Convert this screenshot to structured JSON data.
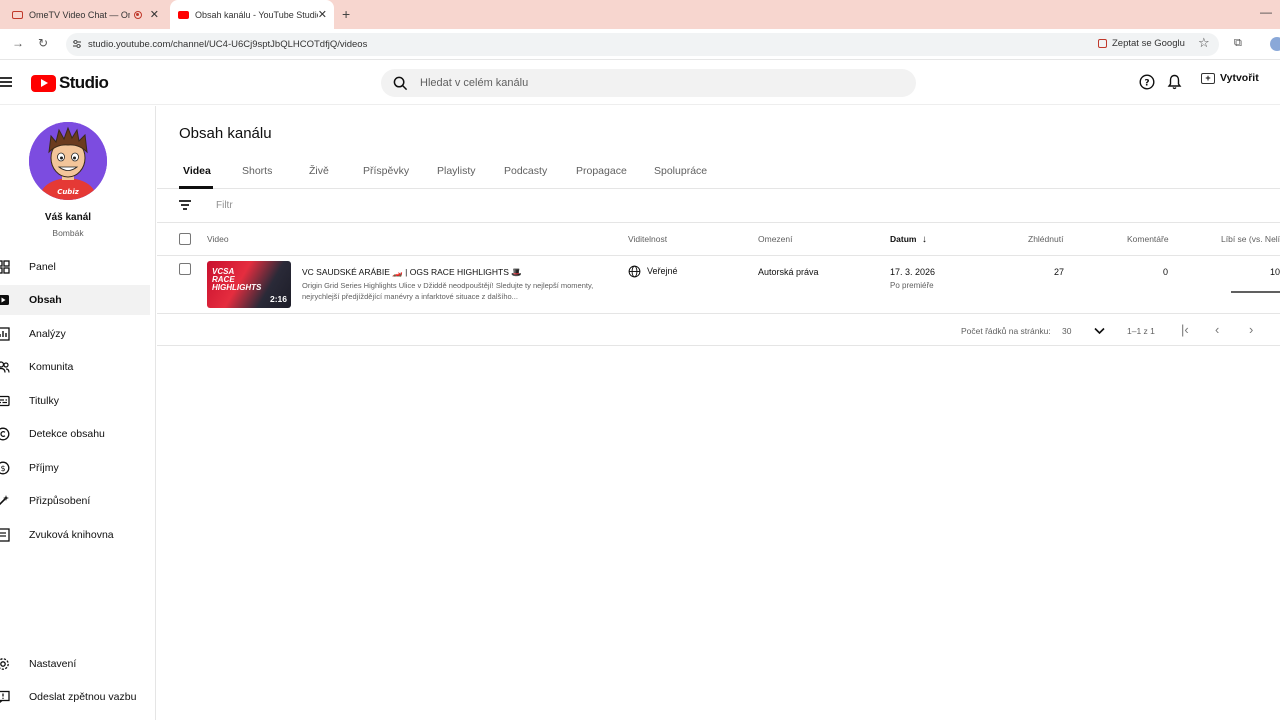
{
  "browser": {
    "tabs": [
      {
        "title": "OmeTV Video Chat — Omegle",
        "active": false
      },
      {
        "title": "Obsah kanálu - YouTube Studio",
        "active": true
      }
    ],
    "url": "studio.youtube.com/channel/UC4-U6Cj9sptJbQLHCOTdfjQ/videos",
    "ask_google": "Zeptat se Googlu"
  },
  "header": {
    "logo_text": "Studio",
    "search_placeholder": "Hledat v celém kanálu",
    "create_label": "Vytvořit"
  },
  "sidebar": {
    "channel_label": "Váš kanál",
    "channel_name": "Bombák",
    "items": [
      {
        "label": "Panel",
        "icon": "dashboard-icon"
      },
      {
        "label": "Obsah",
        "icon": "content-icon",
        "active": true
      },
      {
        "label": "Analýzy",
        "icon": "analytics-icon"
      },
      {
        "label": "Komunita",
        "icon": "community-icon"
      },
      {
        "label": "Titulky",
        "icon": "subtitles-icon"
      },
      {
        "label": "Detekce obsahu",
        "icon": "copyright-icon"
      },
      {
        "label": "Příjmy",
        "icon": "earn-icon"
      },
      {
        "label": "Přizpůsobení",
        "icon": "customization-icon"
      },
      {
        "label": "Zvuková knihovna",
        "icon": "audio-library-icon"
      }
    ],
    "bottom": [
      {
        "label": "Nastavení",
        "icon": "settings-icon"
      },
      {
        "label": "Odeslat zpětnou vazbu",
        "icon": "feedback-icon"
      }
    ]
  },
  "main": {
    "title": "Obsah kanálu",
    "tabs": [
      "Videa",
      "Shorts",
      "Živě",
      "Příspěvky",
      "Playlisty",
      "Podcasty",
      "Propagace",
      "Spolupráce"
    ],
    "active_tab": "Videa",
    "filter_placeholder": "Filtr",
    "columns": {
      "video": "Video",
      "visibility": "Viditelnost",
      "restrictions": "Omezení",
      "date": "Datum",
      "views": "Zhlédnutí",
      "comments": "Komentáře",
      "likes": "Líbí se (vs. Nelíbí se)"
    },
    "rows": [
      {
        "title": "VC SAUDSKÉ ARÁBIE 🏎️ | OGS RACE HIGHLIGHTS 🎩",
        "description": "Origin Grid Series Highlights Ulice v Džiddě neodpouštějí! Sledujte ty nejlepší momenty, nejrychlejší předjíždějící manévry a infarktové situace z dalšího...",
        "duration": "2:16",
        "thumb_text": "VCSA RACE HIGHLIGHTS",
        "visibility": "Veřejné",
        "restrictions": "Autorská práva",
        "date": "17. 3. 2026",
        "date_sub": "Po premiéře",
        "views": "27",
        "comments": "0",
        "likes": "10"
      }
    ],
    "pager": {
      "rows_per_page_label": "Počet řádků na stránku:",
      "rows_per_page": "30",
      "range": "1–1 z 1"
    }
  }
}
